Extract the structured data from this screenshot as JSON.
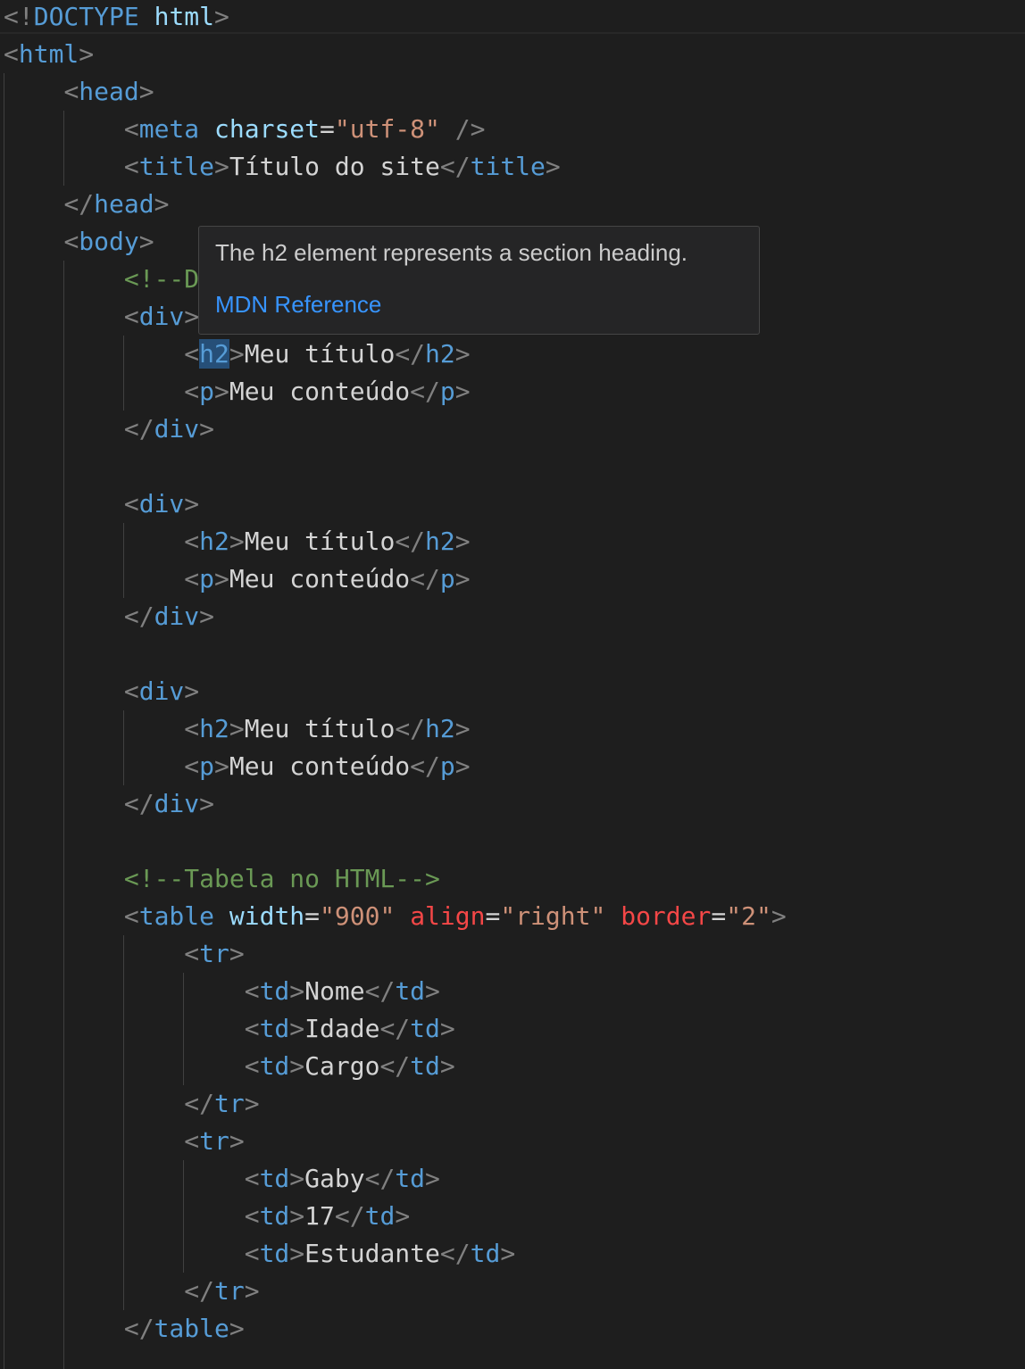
{
  "editor": {
    "lines": [
      {
        "parts": [
          [
            "b",
            "<!"
          ],
          [
            "t",
            "DOCTYPE"
          ],
          [
            "tx",
            " "
          ],
          [
            "a",
            "html"
          ],
          [
            "b",
            ">"
          ]
        ]
      },
      {
        "parts": [
          [
            "b",
            "<"
          ],
          [
            "t",
            "html"
          ],
          [
            "b",
            ">"
          ]
        ]
      },
      {
        "parts": [
          [
            "tx",
            "    "
          ],
          [
            "b",
            "<"
          ],
          [
            "t",
            "head"
          ],
          [
            "b",
            ">"
          ]
        ]
      },
      {
        "parts": [
          [
            "tx",
            "        "
          ],
          [
            "b",
            "<"
          ],
          [
            "t",
            "meta"
          ],
          [
            "tx",
            " "
          ],
          [
            "a",
            "charset"
          ],
          [
            "tx",
            "="
          ],
          [
            "s",
            "\"utf-8\""
          ],
          [
            "tx",
            " "
          ],
          [
            "b",
            "/>"
          ]
        ]
      },
      {
        "parts": [
          [
            "tx",
            "        "
          ],
          [
            "b",
            "<"
          ],
          [
            "t",
            "title"
          ],
          [
            "b",
            ">"
          ],
          [
            "tx",
            "Título do site"
          ],
          [
            "b",
            "</"
          ],
          [
            "t",
            "title"
          ],
          [
            "b",
            ">"
          ]
        ]
      },
      {
        "parts": [
          [
            "tx",
            "    "
          ],
          [
            "b",
            "</"
          ],
          [
            "t",
            "head"
          ],
          [
            "b",
            ">"
          ]
        ]
      },
      {
        "parts": [
          [
            "tx",
            "    "
          ],
          [
            "b",
            "<"
          ],
          [
            "t",
            "body"
          ],
          [
            "b",
            ">"
          ]
        ]
      },
      {
        "parts": [
          [
            "tx",
            "        "
          ],
          [
            "c",
            "<!--D"
          ]
        ]
      },
      {
        "parts": [
          [
            "tx",
            "        "
          ],
          [
            "b",
            "<"
          ],
          [
            "t",
            "div"
          ],
          [
            "b",
            ">"
          ]
        ]
      },
      {
        "parts": [
          [
            "tx",
            "            "
          ],
          [
            "b",
            "<"
          ],
          [
            "t",
            "h2",
            "hl"
          ],
          [
            "b",
            ">"
          ],
          [
            "tx",
            "Meu título"
          ],
          [
            "b",
            "</"
          ],
          [
            "t",
            "h2"
          ],
          [
            "b",
            ">"
          ]
        ]
      },
      {
        "parts": [
          [
            "tx",
            "            "
          ],
          [
            "b",
            "<"
          ],
          [
            "t",
            "p"
          ],
          [
            "b",
            ">"
          ],
          [
            "tx",
            "Meu conteúdo"
          ],
          [
            "b",
            "</"
          ],
          [
            "t",
            "p"
          ],
          [
            "b",
            ">"
          ]
        ]
      },
      {
        "parts": [
          [
            "tx",
            "        "
          ],
          [
            "b",
            "</"
          ],
          [
            "t",
            "div"
          ],
          [
            "b",
            ">"
          ]
        ]
      },
      {
        "parts": []
      },
      {
        "parts": [
          [
            "tx",
            "        "
          ],
          [
            "b",
            "<"
          ],
          [
            "t",
            "div"
          ],
          [
            "b",
            ">"
          ]
        ]
      },
      {
        "parts": [
          [
            "tx",
            "            "
          ],
          [
            "b",
            "<"
          ],
          [
            "t",
            "h2"
          ],
          [
            "b",
            ">"
          ],
          [
            "tx",
            "Meu título"
          ],
          [
            "b",
            "</"
          ],
          [
            "t",
            "h2"
          ],
          [
            "b",
            ">"
          ]
        ]
      },
      {
        "parts": [
          [
            "tx",
            "            "
          ],
          [
            "b",
            "<"
          ],
          [
            "t",
            "p"
          ],
          [
            "b",
            ">"
          ],
          [
            "tx",
            "Meu conteúdo"
          ],
          [
            "b",
            "</"
          ],
          [
            "t",
            "p"
          ],
          [
            "b",
            ">"
          ]
        ]
      },
      {
        "parts": [
          [
            "tx",
            "        "
          ],
          [
            "b",
            "</"
          ],
          [
            "t",
            "div"
          ],
          [
            "b",
            ">"
          ]
        ]
      },
      {
        "parts": []
      },
      {
        "parts": [
          [
            "tx",
            "        "
          ],
          [
            "b",
            "<"
          ],
          [
            "t",
            "div"
          ],
          [
            "b",
            ">"
          ]
        ]
      },
      {
        "parts": [
          [
            "tx",
            "            "
          ],
          [
            "b",
            "<"
          ],
          [
            "t",
            "h2"
          ],
          [
            "b",
            ">"
          ],
          [
            "tx",
            "Meu título"
          ],
          [
            "b",
            "</"
          ],
          [
            "t",
            "h2"
          ],
          [
            "b",
            ">"
          ]
        ]
      },
      {
        "parts": [
          [
            "tx",
            "            "
          ],
          [
            "b",
            "<"
          ],
          [
            "t",
            "p"
          ],
          [
            "b",
            ">"
          ],
          [
            "tx",
            "Meu conteúdo"
          ],
          [
            "b",
            "</"
          ],
          [
            "t",
            "p"
          ],
          [
            "b",
            ">"
          ]
        ]
      },
      {
        "parts": [
          [
            "tx",
            "        "
          ],
          [
            "b",
            "</"
          ],
          [
            "t",
            "div"
          ],
          [
            "b",
            ">"
          ]
        ]
      },
      {
        "parts": []
      },
      {
        "parts": [
          [
            "tx",
            "        "
          ],
          [
            "c",
            "<!--Tabela no HTML-->"
          ]
        ]
      },
      {
        "parts": [
          [
            "tx",
            "        "
          ],
          [
            "b",
            "<"
          ],
          [
            "t",
            "table"
          ],
          [
            "tx",
            " "
          ],
          [
            "a",
            "width"
          ],
          [
            "tx",
            "="
          ],
          [
            "s",
            "\"900\""
          ],
          [
            "tx",
            " "
          ],
          [
            "ar",
            "align"
          ],
          [
            "tx",
            "="
          ],
          [
            "s",
            "\"right\""
          ],
          [
            "tx",
            " "
          ],
          [
            "ar",
            "border"
          ],
          [
            "tx",
            "="
          ],
          [
            "s",
            "\"2\""
          ],
          [
            "b",
            ">"
          ]
        ]
      },
      {
        "parts": [
          [
            "tx",
            "            "
          ],
          [
            "b",
            "<"
          ],
          [
            "t",
            "tr"
          ],
          [
            "b",
            ">"
          ]
        ]
      },
      {
        "parts": [
          [
            "tx",
            "                "
          ],
          [
            "b",
            "<"
          ],
          [
            "t",
            "td"
          ],
          [
            "b",
            ">"
          ],
          [
            "tx",
            "Nome"
          ],
          [
            "b",
            "</"
          ],
          [
            "t",
            "td"
          ],
          [
            "b",
            ">"
          ]
        ]
      },
      {
        "parts": [
          [
            "tx",
            "                "
          ],
          [
            "b",
            "<"
          ],
          [
            "t",
            "td"
          ],
          [
            "b",
            ">"
          ],
          [
            "tx",
            "Idade"
          ],
          [
            "b",
            "</"
          ],
          [
            "t",
            "td"
          ],
          [
            "b",
            ">"
          ]
        ]
      },
      {
        "parts": [
          [
            "tx",
            "                "
          ],
          [
            "b",
            "<"
          ],
          [
            "t",
            "td"
          ],
          [
            "b",
            ">"
          ],
          [
            "tx",
            "Cargo"
          ],
          [
            "b",
            "</"
          ],
          [
            "t",
            "td"
          ],
          [
            "b",
            ">"
          ]
        ]
      },
      {
        "parts": [
          [
            "tx",
            "            "
          ],
          [
            "b",
            "</"
          ],
          [
            "t",
            "tr"
          ],
          [
            "b",
            ">"
          ]
        ]
      },
      {
        "parts": [
          [
            "tx",
            "            "
          ],
          [
            "b",
            "<"
          ],
          [
            "t",
            "tr"
          ],
          [
            "b",
            ">"
          ]
        ]
      },
      {
        "parts": [
          [
            "tx",
            "                "
          ],
          [
            "b",
            "<"
          ],
          [
            "t",
            "td"
          ],
          [
            "b",
            ">"
          ],
          [
            "tx",
            "Gaby"
          ],
          [
            "b",
            "</"
          ],
          [
            "t",
            "td"
          ],
          [
            "b",
            ">"
          ]
        ]
      },
      {
        "parts": [
          [
            "tx",
            "                "
          ],
          [
            "b",
            "<"
          ],
          [
            "t",
            "td"
          ],
          [
            "b",
            ">"
          ],
          [
            "tx",
            "17"
          ],
          [
            "b",
            "</"
          ],
          [
            "t",
            "td"
          ],
          [
            "b",
            ">"
          ]
        ]
      },
      {
        "parts": [
          [
            "tx",
            "                "
          ],
          [
            "b",
            "<"
          ],
          [
            "t",
            "td"
          ],
          [
            "b",
            ">"
          ],
          [
            "tx",
            "Estudante"
          ],
          [
            "b",
            "</"
          ],
          [
            "t",
            "td"
          ],
          [
            "b",
            ">"
          ]
        ]
      },
      {
        "parts": [
          [
            "tx",
            "            "
          ],
          [
            "b",
            "</"
          ],
          [
            "t",
            "tr"
          ],
          [
            "b",
            ">"
          ]
        ]
      },
      {
        "parts": [
          [
            "tx",
            "        "
          ],
          [
            "b",
            "</"
          ],
          [
            "t",
            "table"
          ],
          [
            "b",
            ">"
          ]
        ]
      }
    ]
  },
  "hover": {
    "description": "The h2 element represents a section heading.",
    "link_label": "MDN Reference"
  },
  "colors": {
    "background": "#1e1e1e",
    "tag": "#569cd6",
    "bracket": "#808080",
    "attribute": "#9cdcfe",
    "attribute_unknown": "#f44747",
    "string": "#ce9178",
    "comment": "#6a9955",
    "text": "#d4d4d4",
    "link": "#3794ff"
  }
}
